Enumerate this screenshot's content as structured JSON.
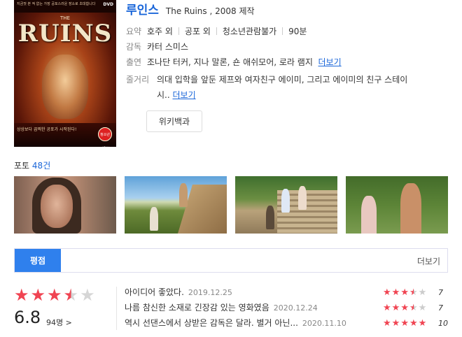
{
  "movie": {
    "title_kor": "루인스",
    "title_eng": "The Ruins , 2008 제작",
    "poster": {
      "top_text": "지금껏 본 적 없는 가장 공포스러운 장소로 초대합니다",
      "the": "THE",
      "title": "RUINS",
      "dvd": "DVD",
      "bottom_text": "상상보다 끔찍한 공포가 시작된다!",
      "badge": "청소년관람불가"
    }
  },
  "info": {
    "summary_label": "요약",
    "summary": [
      "호주 외",
      "공포 외",
      "청소년관람불가",
      "90분"
    ],
    "director_label": "감독",
    "director": "카터 스미스",
    "cast_label": "출연",
    "cast": "조나단 터커, 지나 말론, 숀 애쉬모어, 로라 램지",
    "cast_more": "더보기",
    "plot_label": "줄거리",
    "plot_line1": "의대 입학을 앞둔 제프와 여자친구 에이미, 그리고 에이미의 친구 스테이",
    "plot_line2": "시..",
    "plot_more": "더보기",
    "wiki_button": "위키백과"
  },
  "photos": {
    "label": "포토",
    "count": "48건",
    "items": [
      "photo-1",
      "photo-2",
      "photo-3",
      "photo-4"
    ]
  },
  "rating": {
    "tab_label": "평점",
    "more_label": "더보기",
    "average": "6.8",
    "average_stars": 3.5,
    "count": "94명",
    "count_arrow": ">",
    "reviews": [
      {
        "text": "아이디어 좋았다.",
        "date": "2019.12.25",
        "stars": 3.5,
        "score": "7"
      },
      {
        "text": "나름 참신한 소재로 긴장감 있는 영화였음",
        "date": "2020.12.24",
        "stars": 3.5,
        "score": "7"
      },
      {
        "text": "역시 선댄스에서 상받은 감독은 달라. 별거 아닌...",
        "date": "2020.11.10",
        "stars": 5,
        "score": "10"
      }
    ]
  },
  "colors": {
    "accent": "#1a66d9",
    "tab": "#2f80ed",
    "star": "#f04452",
    "star_empty": "#d6d6d6"
  }
}
